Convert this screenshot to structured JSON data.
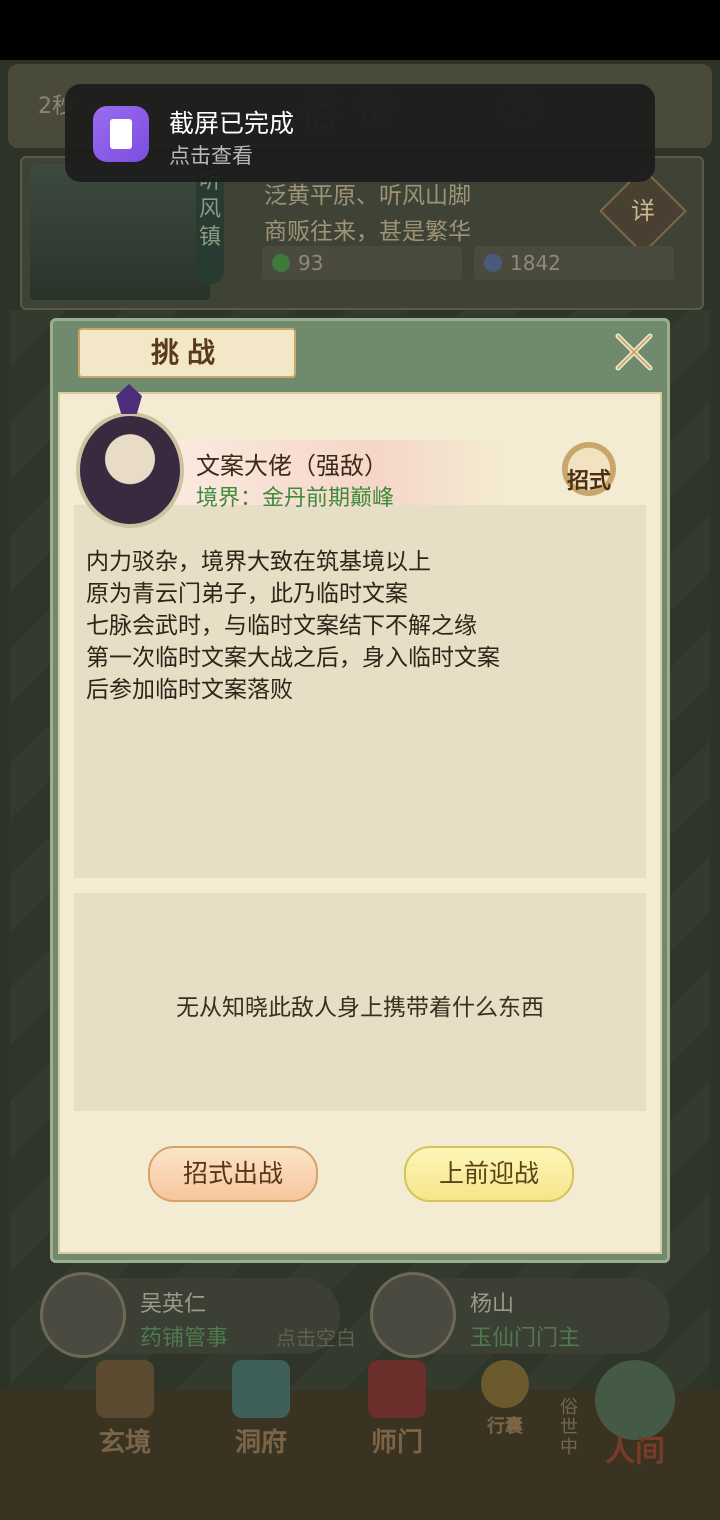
{
  "notification": {
    "title": "截屏已完成",
    "subtitle": "点击查看"
  },
  "background": {
    "timer": "2秒",
    "location_title": "俗 世",
    "help": "?",
    "town_name": "听风镇",
    "town_desc_1": "泛黄平原、听风山脚",
    "town_desc_2": "商贩往来，甚是繁华",
    "detail": "详",
    "stat_1": "93",
    "stat_2": "1842",
    "npcs": [
      {
        "name": "吴英仁",
        "role": "药铺管事"
      },
      {
        "name": "杨山",
        "role": "玉仙门门主"
      }
    ],
    "tap_hint": "点击空白",
    "nav": [
      "玄境",
      "洞府",
      "师门",
      "行囊",
      "人间"
    ],
    "side_tag": "俗世中"
  },
  "dialog": {
    "title": "挑战",
    "enemy": {
      "name": "文案大佬（强敌）",
      "realm": "境界：金丹前期巅峰"
    },
    "moves_label": "招式",
    "description": [
      "内力驳杂，境界大致在筑基境以上",
      "原为青云门弟子，此乃临时文案",
      "七脉会武时，与临时文案结下不解之缘",
      "第一次临时文案大战之后，身入临时文案",
      "后参加临时文案落败"
    ],
    "loot_text": "无从知晓此敌人身上携带着什么东西",
    "buttons": {
      "moves_fight": "招式出战",
      "fight": "上前迎战"
    }
  },
  "colors": {
    "frame_green": "#6f8a6c",
    "parchment": "#f3ecd2",
    "realm_green": "#3b8d3b",
    "notif_bg": "#1c1c1c",
    "app_icon": "#8a5ce8"
  }
}
